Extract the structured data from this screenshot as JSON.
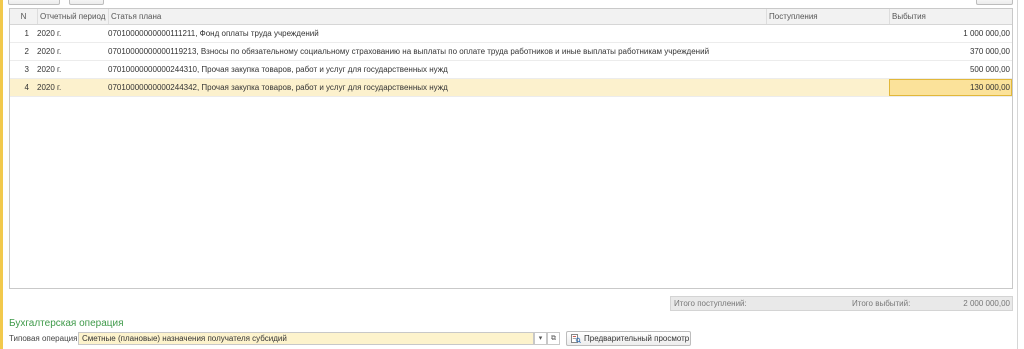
{
  "table": {
    "columns": {
      "n": "N",
      "period": "Отчетный период",
      "article": "Статья плана",
      "income": "Поступления",
      "outflow": "Выбытия"
    },
    "rows": [
      {
        "n": "1",
        "period": "2020 г.",
        "article": "07010000000000111211, Фонд оплаты труда учреждений",
        "income": "",
        "outflow": "1 000 000,00"
      },
      {
        "n": "2",
        "period": "2020 г.",
        "article": "07010000000000119213, Взносы по обязательному социальному страхованию на выплаты по оплате труда работников и иные выплаты работникам учреждений",
        "income": "",
        "outflow": "370 000,00"
      },
      {
        "n": "3",
        "period": "2020 г.",
        "article": "07010000000000244310, Прочая закупка товаров, работ и услуг для государственных нужд",
        "income": "",
        "outflow": "500 000,00"
      },
      {
        "n": "4",
        "period": "2020 г.",
        "article": "07010000000000244342, Прочая закупка товаров, работ и услуг для государственных нужд",
        "income": "",
        "outflow": "130 000,00"
      }
    ]
  },
  "totals": {
    "income_label": "Итого поступлений:",
    "income_value": "",
    "outflow_label": "Итого выбытий:",
    "outflow_value": "2 000 000,00"
  },
  "accounting": {
    "section_title": "Бухгалтерская операция",
    "operation_label": "Типовая операция:",
    "operation_value": "Сметные (плановые) назначения получателя субсидий",
    "dropdown_glyph": "▾",
    "open_glyph": "⧉",
    "preview_button": "Предварительный просмотр"
  },
  "icons": {
    "preview": "preview-document-icon",
    "dropdown": "chevron-down-icon",
    "open": "open-form-icon"
  },
  "colors": {
    "selected_row": "#fcf1cd",
    "active_cell": "#fbe29a",
    "section_title": "#3f9a4a",
    "input_background": "#fdf3cc"
  }
}
